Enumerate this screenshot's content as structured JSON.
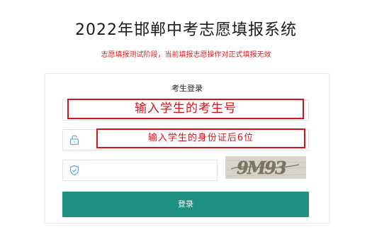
{
  "page": {
    "title": "2022年邯郸中考志愿填报系统",
    "notice": "志愿填报测试阶段，当前填报志愿操作对正式填报无效"
  },
  "login": {
    "card_title": "考生登录",
    "username_hint": "输入学生的考生号",
    "password_hint": "输入学生的身份证后6位",
    "captcha_value": "",
    "captcha_text": "9M93",
    "submit_label": "登录"
  },
  "colors": {
    "accent": "#1d9081",
    "notice": "#e02020",
    "hint_border": "#d8111b",
    "icon": "#6aa6e0"
  },
  "icons": {
    "username": "user-icon",
    "password": "lock-icon",
    "captcha": "shield-icon"
  }
}
